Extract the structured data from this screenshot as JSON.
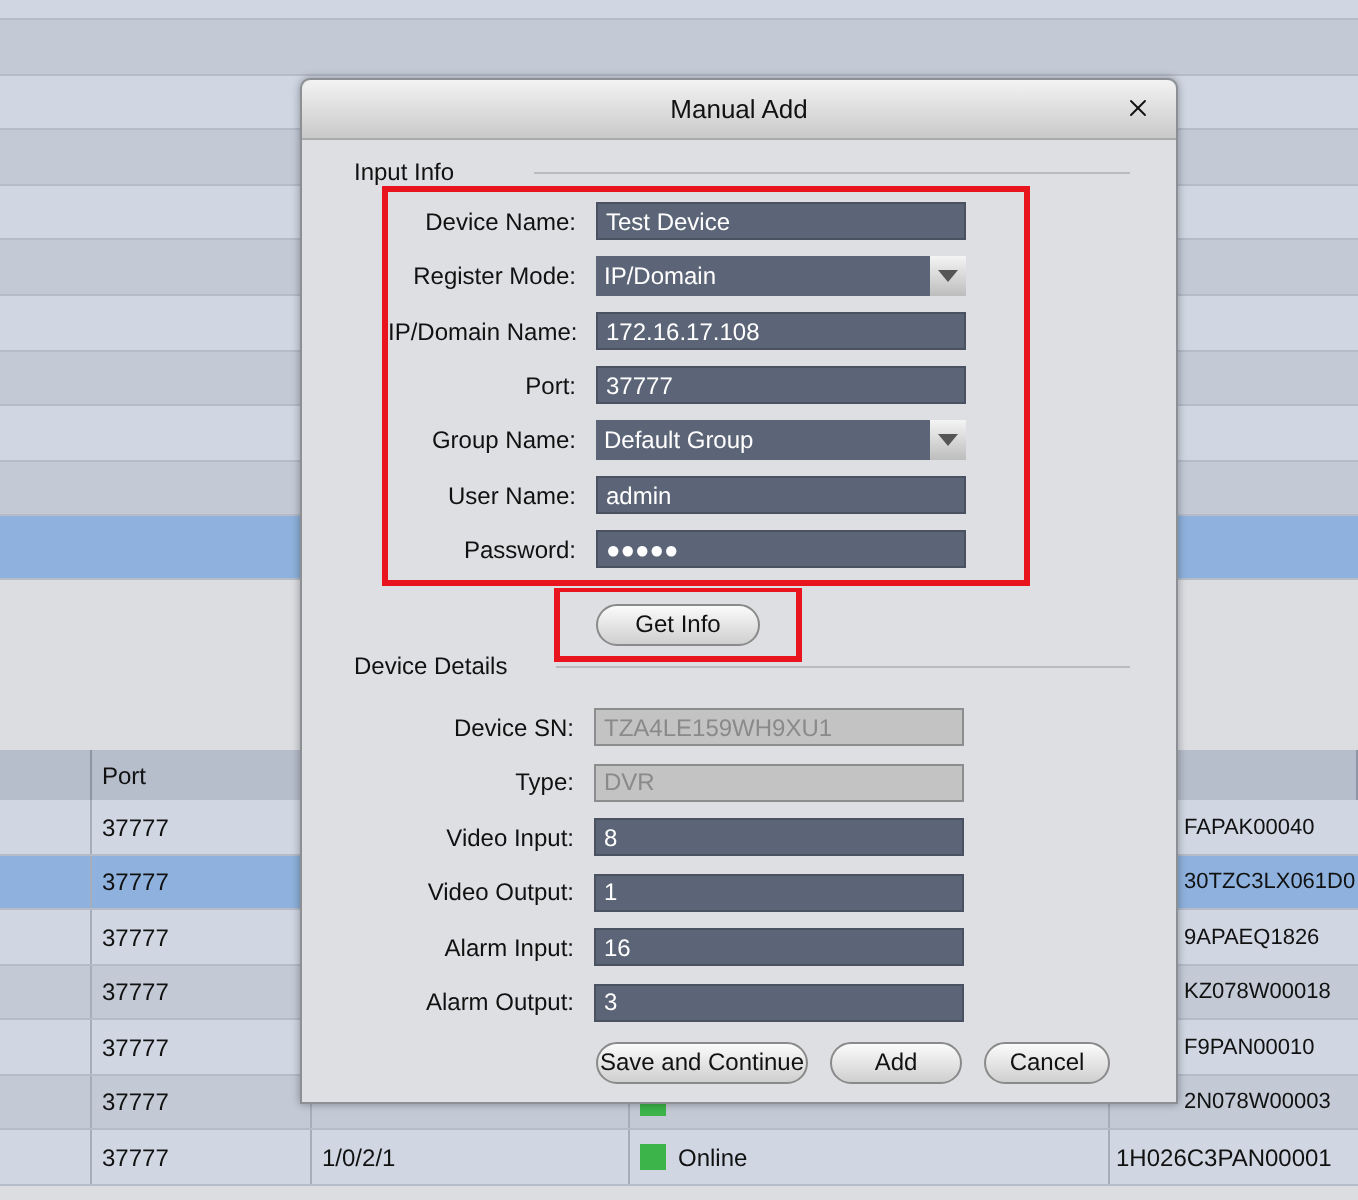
{
  "background_table": {
    "top_rows": [
      {
        "selected": false
      },
      {
        "selected": false
      },
      {
        "selected": false
      },
      {
        "selected": false
      },
      {
        "selected": false
      },
      {
        "selected": false
      },
      {
        "selected": false
      },
      {
        "selected": false
      },
      {
        "selected": false
      },
      {
        "selected": false
      },
      {
        "selected": true
      }
    ],
    "header": {
      "column_2": "Port"
    },
    "rows": [
      {
        "selected": false,
        "port": "37777",
        "column_5": "FAPAK00040"
      },
      {
        "selected": true,
        "port": "37777",
        "column_5": "30TZC3LX061D0"
      },
      {
        "selected": false,
        "port": "37777",
        "column_5": "9APAEQ1826"
      },
      {
        "selected": false,
        "port": "37777",
        "column_5": "KZ078W00018"
      },
      {
        "selected": false,
        "port": "37777",
        "column_5": "F9PAN00010"
      },
      {
        "selected": false,
        "port": "37777",
        "color": "#3cb44a",
        "column_5": "2N078W00003"
      },
      {
        "selected": false,
        "port": "37777",
        "column_3": "1/0/2/1",
        "status": "Online",
        "color": "#3cb44a",
        "column_5": "1H026C3PAN00001"
      }
    ]
  },
  "dialog": {
    "title": "Manual Add",
    "input_info": {
      "title": "Input Info",
      "highlighted": true,
      "fields": [
        {
          "kind": "text",
          "label": "Device Name:",
          "value": "Test Device"
        },
        {
          "kind": "dropdown",
          "label": "Register Mode:",
          "value": "IP/Domain"
        },
        {
          "kind": "text",
          "label": "IP/Domain Name:",
          "value": "172.16.17.108"
        },
        {
          "kind": "text",
          "label": "Port:",
          "value": "37777"
        },
        {
          "kind": "dropdown",
          "label": "Group Name:",
          "value": "Default Group"
        },
        {
          "kind": "text",
          "label": "User Name:",
          "value": "admin"
        },
        {
          "kind": "text",
          "label": "Password:",
          "value": "●●●●●"
        }
      ]
    },
    "get_info": {
      "label": "Get Info",
      "highlighted": true
    },
    "device_details": {
      "title": "Device Details",
      "fields": [
        {
          "label": "Device SN:",
          "value": "TZA4LE159WH9XU1",
          "disabled": true
        },
        {
          "label": "Type:",
          "value": "DVR",
          "disabled": true
        },
        {
          "label": "Video Input:",
          "value": "8",
          "disabled": false
        },
        {
          "label": "Video Output:",
          "value": "1",
          "disabled": false
        },
        {
          "label": "Alarm Input:",
          "value": "16",
          "disabled": false
        },
        {
          "label": "Alarm Output:",
          "value": "3",
          "disabled": false
        }
      ]
    },
    "buttons": [
      "Save and Continue",
      "Add",
      "Cancel"
    ]
  }
}
